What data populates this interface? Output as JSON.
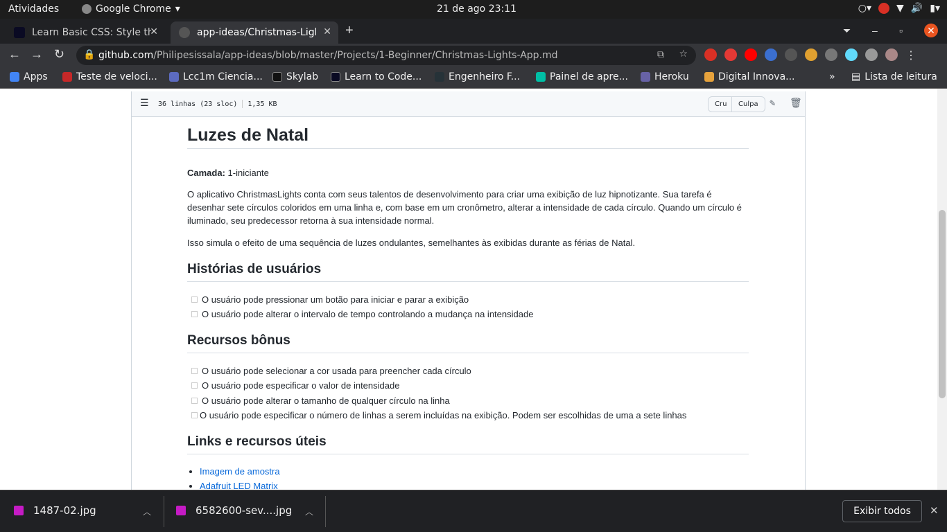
{
  "topbar": {
    "activities": "Atividades",
    "app": "Google Chrome",
    "clock": "21 de ago  23:11"
  },
  "tabs": [
    {
      "label": "Learn Basic CSS: Style the"
    },
    {
      "label": "app-ideas/Christmas-Ligh"
    }
  ],
  "address": {
    "host": "github.com",
    "path": "/Philipesissala/app-ideas/blob/master/Projects/1-Beginner/Christmas-Lights-App.md"
  },
  "bookmarks": [
    "Apps",
    "Teste de veloci...",
    "Lcc1m Ciencia...",
    "Skylab",
    "Learn to Code...",
    "Engenheiro F...",
    "Painel de apre...",
    "Heroku",
    "Digital Innova..."
  ],
  "bookmarks_more": "Lista de leitura",
  "file": {
    "lines": "36 linhas (23 sloc)",
    "size": "1,35 KB",
    "raw": "Cru",
    "blame": "Culpa"
  },
  "doc": {
    "title": "Luzes de Natal",
    "tier_label": "Camada:",
    "tier_value": "1-iniciante",
    "p1": "O aplicativo ChristmasLights conta com seus talentos de desenvolvimento para criar uma exibição de luz hipnotizante. Sua tarefa é desenhar sete círculos coloridos em uma linha e, com base em um cronômetro, alterar a intensidade de cada círculo. Quando um círculo é iluminado, seu predecessor retorna à sua intensidade normal.",
    "p2": "Isso simula o efeito de uma sequência de luzes ondulantes, semelhantes às exibidas durante as férias de Natal.",
    "h_stories": "Histórias de usuários",
    "stories": [
      "O usuário pode pressionar um botão para iniciar e parar a exibição",
      "O usuário pode alterar o intervalo de tempo controlando a mudança na intensidade"
    ],
    "h_bonus": "Recursos bônus",
    "bonus": [
      "O usuário pode selecionar a cor usada para preencher cada círculo",
      "O usuário pode especificar o valor de intensidade",
      "O usuário pode alterar o tamanho de qualquer círculo na linha",
      "O usuário pode especificar o número de linhas a serem incluídas na exibição. Podem ser escolhidas de uma a sete linhas"
    ],
    "h_links": "Links e recursos úteis",
    "links": [
      "Imagem de amostra",
      "Adafruit LED Matrix"
    ]
  },
  "downloads": [
    {
      "name": "1487-02.jpg"
    },
    {
      "name": "6582600-sev....jpg"
    }
  ],
  "show_all": "Exibir todos"
}
